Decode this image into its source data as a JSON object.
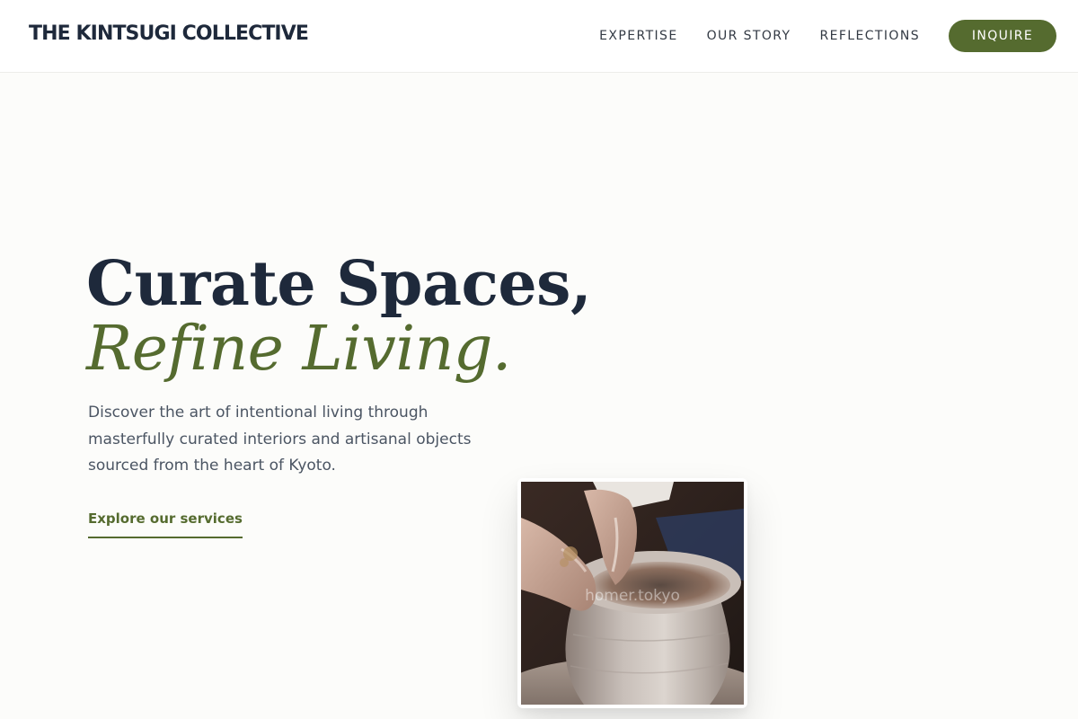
{
  "header": {
    "brand": "THE KINTSUGI COLLECTIVE",
    "nav": [
      {
        "label": "EXPERTISE"
      },
      {
        "label": "OUR STORY"
      },
      {
        "label": "REFLECTIONS"
      }
    ],
    "cta_label": "INQUIRE"
  },
  "hero": {
    "title_line1": "Curate Spaces,",
    "title_line2": "Refine Living.",
    "description": "Discover the art of intentional living through masterfully curated interiors and artisanal objects sourced from the heart of Kyoto.",
    "link_label": "Explore our services"
  },
  "image": {
    "watermark": "homer.tokyo",
    "icon": "pottery-wheel-photo"
  },
  "colors": {
    "accent": "#556b2f",
    "heading": "#1e293b",
    "body_text": "#4b5563",
    "background": "#fcfcfa"
  }
}
